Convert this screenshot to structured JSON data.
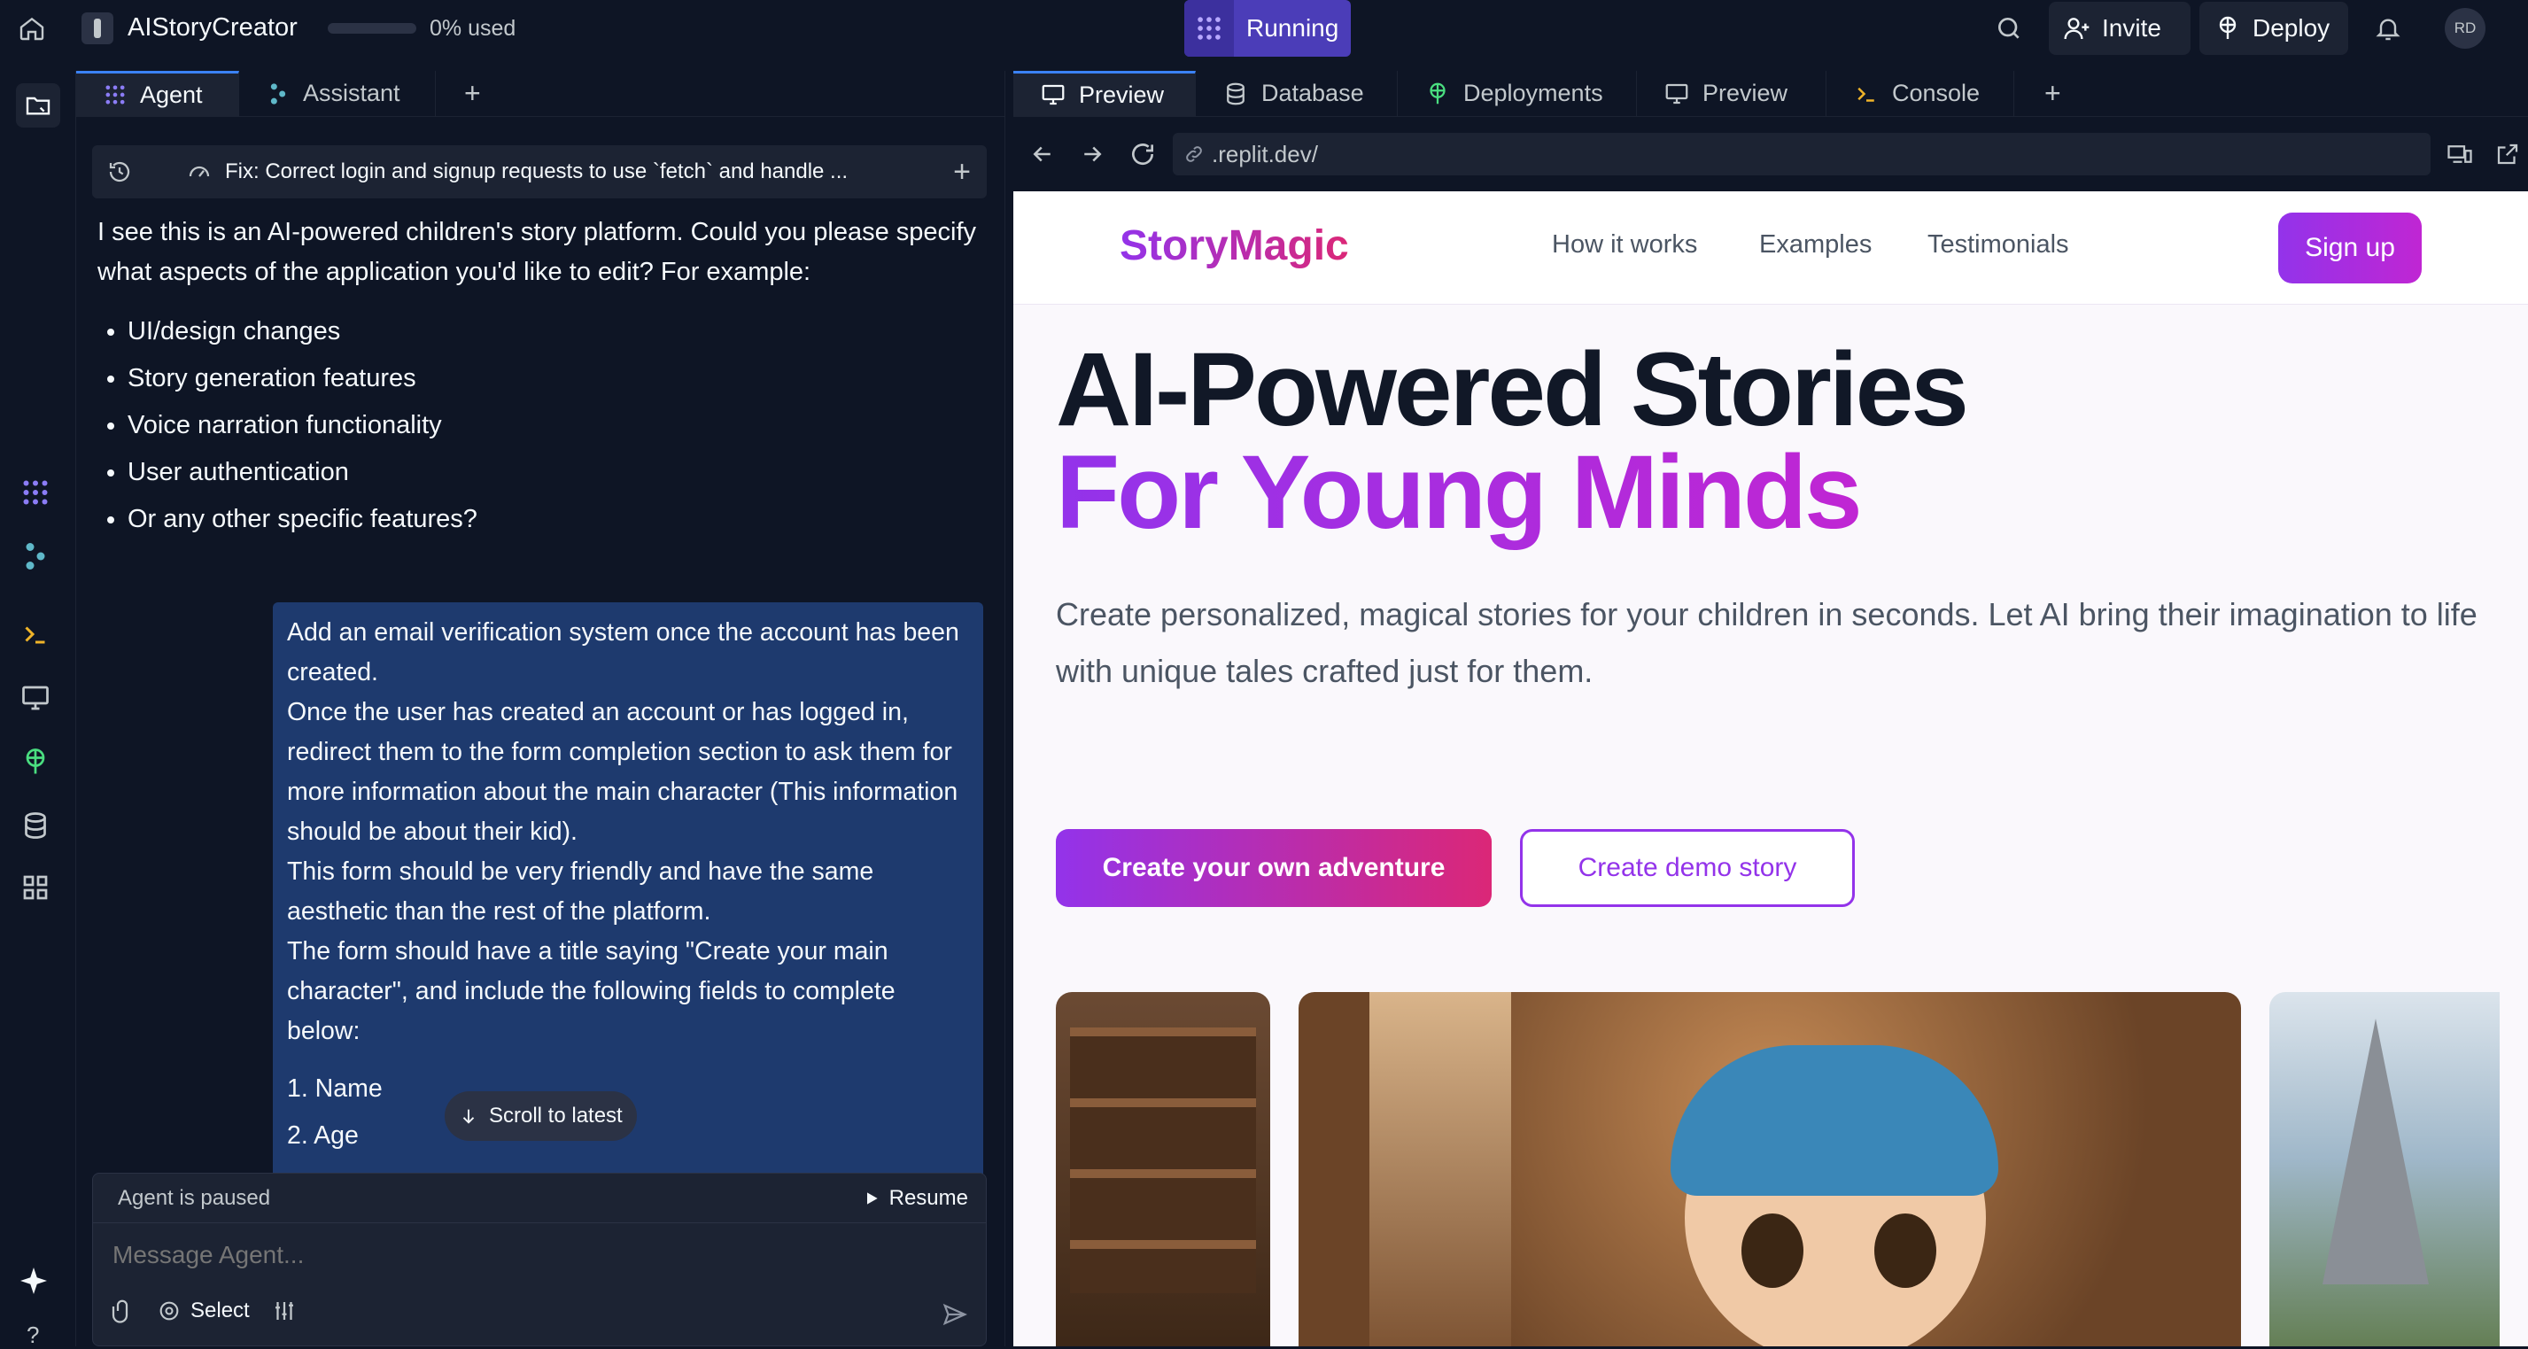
{
  "app": {
    "title": "AIStoryCreator",
    "usage": "0% used",
    "usage_fraction": 0.0,
    "run_status": "Running"
  },
  "topbar": {
    "invite_label": "Invite",
    "deploy_label": "Deploy",
    "avatar_initials": "RD"
  },
  "agent_panel": {
    "tabs": [
      {
        "label": "Agent"
      },
      {
        "label": "Assistant"
      }
    ],
    "thread_title": "Fix: Correct login and signup requests to use `fetch` and handle ...",
    "agent_message": {
      "intro": "I see this is an AI-powered children's story platform. Could you please specify what aspects of the application you'd like to edit? For example:",
      "bullets": [
        "UI/design changes",
        "Story generation features",
        "Voice narration functionality",
        "User authentication",
        "Or any other specific features?"
      ]
    },
    "user_message": {
      "lines": [
        "Add an email verification system once the account has been created.",
        "Once the user has created an account or has logged in, redirect them to the form completion section to ask them for more information about the main character (This information should be about their kid).",
        "This form should be very friendly and have the same aesthetic than the rest of the platform.",
        "The form should have a title saying \"Create your main character\", and include the following fields to complete below:"
      ],
      "list": [
        "1. Name",
        "2. Age"
      ]
    },
    "scroll_label": "Scroll to latest",
    "status": {
      "text": "Agent is paused",
      "resume_label": "Resume"
    },
    "input": {
      "placeholder": "Message Agent...",
      "select_label": "Select"
    }
  },
  "preview_panel": {
    "tabs": [
      {
        "label": "Preview"
      },
      {
        "label": "Database"
      },
      {
        "label": "Deployments"
      },
      {
        "label": "Preview"
      },
      {
        "label": "Console"
      }
    ],
    "url": ".replit.dev/"
  },
  "site": {
    "brand": "StoryMagic",
    "nav": [
      "How it works",
      "Examples",
      "Testimonials"
    ],
    "signup_label": "Sign up",
    "headline_1": "AI-Powered Stories",
    "headline_2": "For Young Minds",
    "subtitle": "Create personalized, magical stories for your children in seconds. Let AI bring their imagination to life with unique tales crafted just for them.",
    "cta_primary": "Create your own adventure",
    "cta_secondary": "Create demo story"
  },
  "colors": {
    "app_bg": "#0e1525",
    "panel_line": "#1c2333",
    "accent": "#3b82f6",
    "brand_purple": "#9333ea",
    "brand_pink": "#db2777",
    "user_bubble": "#1e3a6e"
  }
}
